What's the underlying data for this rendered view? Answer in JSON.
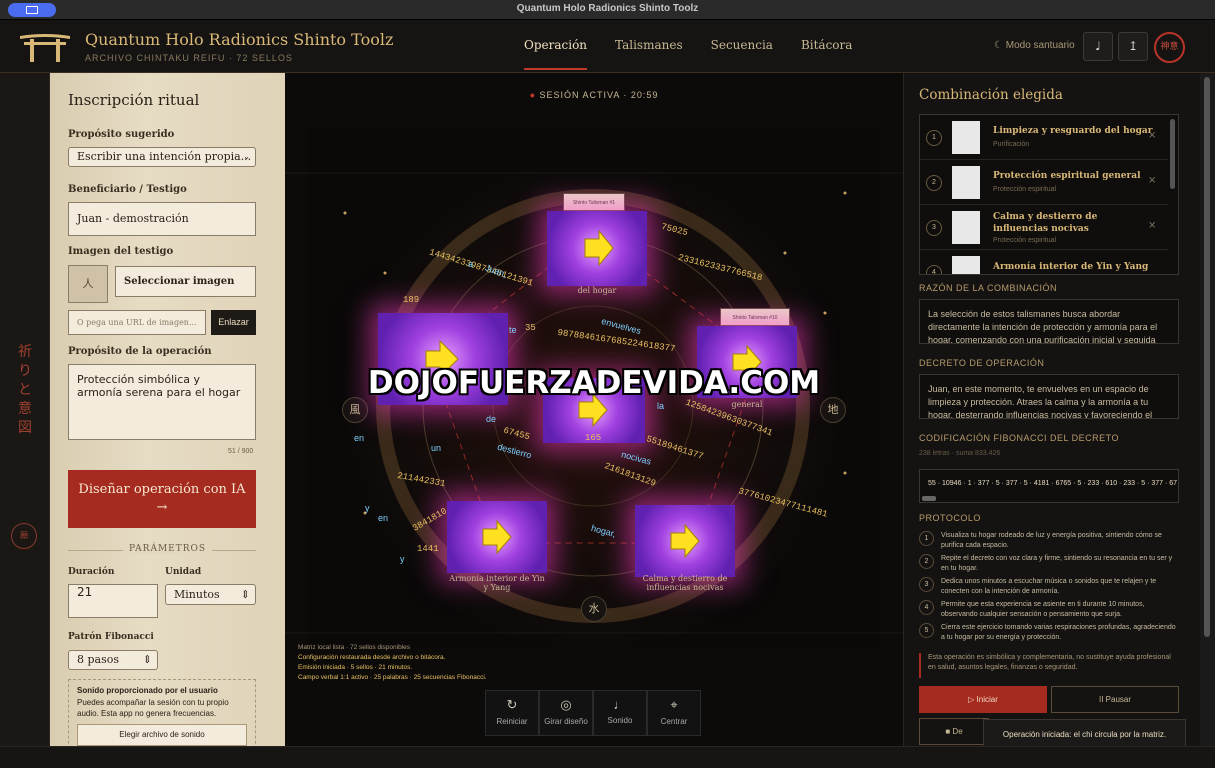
{
  "window": {
    "title": "Quantum Holo Radionics Shinto Toolz"
  },
  "header": {
    "title": "Quantum Holo Radionics Shinto Toolz",
    "subtitle": "ARCHIVO CHINTAKU REIFU · 72 SELLOS",
    "nav": [
      "Operación",
      "Talismanes",
      "Secuencia",
      "Bitácora"
    ],
    "sanctuary": "Modo santuario",
    "music_icon": "♩",
    "upload_icon": "↥",
    "seal": "神意"
  },
  "strip": {
    "vertical": "祈りと意図",
    "seal": "願"
  },
  "form": {
    "title": "Inscripción ritual",
    "purpose_label": "Propósito sugerido",
    "purpose_value": "Escribir una intención propia...",
    "beneficiary_label": "Beneficiario / Testigo",
    "beneficiary_value": "Juan - demostración",
    "image_label": "Imagen del testigo",
    "image_icon": "人",
    "select_image": "Seleccionar imagen",
    "url_placeholder": "O pega una URL de imagen...",
    "link_btn": "Enlazar",
    "op_label": "Propósito de la operación",
    "op_value": "Protección simbólica y armonía serena para el hogar",
    "counter": "51 / 900",
    "design_btn": "Diseñar operación con IA",
    "design_arrow": "→",
    "params": "PARÁMETROS",
    "duration_label": "Duración",
    "duration_value": "21",
    "unit_label": "Unidad",
    "unit_value": "Minutos",
    "fib_label": "Patrón Fibonacci",
    "fib_value": "8 pasos",
    "sound_title": "Sonido proporcionado por el usuario",
    "sound_text": "Puedes acompañar la sesión con tu propio audio. Esta app no genera frecuencias.",
    "sound_btn": "Elegir archivo de sonido"
  },
  "center": {
    "session": "SESIÓN ACTIVA · 20:59",
    "watermark": "DOJOFUERZADEVIDA.COM",
    "elements": {
      "wind": "風",
      "earth": "地",
      "water": "水"
    },
    "talismans": [
      {
        "tag": "Shinto Talisman #1",
        "label": "del hogar"
      },
      {
        "tag": "Shinto Talisman #10",
        "label": "general"
      },
      {
        "tag": "",
        "label": "Armonía interior de Yin y Yang"
      },
      {
        "tag": "",
        "label": "Calma y destierro de influencias nocivas"
      }
    ],
    "fib_numbers": [
      "14434233987345121391",
      "2331623337766518",
      "75025",
      "9878846167685224618377",
      "12584239630377341",
      "55189461377",
      "2161813129",
      "37761023477111481",
      "211442331",
      "3841810",
      "1441",
      "67455",
      "165",
      "35",
      "189"
    ],
    "fib_words": [
      "a",
      "Juan,",
      "envuelves",
      "te",
      "la",
      "de",
      "un",
      "destierro",
      "nocivas",
      "hogar,",
      "en",
      "y",
      "en",
      "y"
    ],
    "log": [
      "Matriz local lista · 72 sellos disponibles",
      "Configuración restaurada desde archivo o bitácora.",
      "Emisión iniciada · 5 sellos · 21 minutos.",
      "Campo verbal 1:1 activo · 25 palabras · 25 secuencias Fibonacci."
    ],
    "controls": [
      {
        "icon": "↻",
        "label": "Reiniciar"
      },
      {
        "icon": "◎",
        "label": "Girar diseño"
      },
      {
        "icon": "♩",
        "label": "Sonido"
      },
      {
        "icon": "⌖",
        "label": "Centrar"
      }
    ]
  },
  "right": {
    "title": "Combinación elegida",
    "items": [
      {
        "n": "1",
        "name": "Limpieza y resguardo del hogar",
        "cat": "Purificación"
      },
      {
        "n": "2",
        "name": "Protección espiritual general",
        "cat": "Protección espiritual"
      },
      {
        "n": "3",
        "name": "Calma y destierro de influencias nocivas",
        "cat": "Protección espiritual"
      },
      {
        "n": "4",
        "name": "Armonía interior de Yin y Yang",
        "cat": ""
      }
    ],
    "reason_label": "RAZÓN DE LA COMBINACIÓN",
    "reason_text": "La selección de estos talismanes busca abordar directamente la intención de protección y armonía para el hogar, comenzando con una purificación inicial y seguida de una",
    "decree_label": "DECRETO DE OPERACIÓN",
    "decree_text": "Juan, en este momento, te envuelves en un espacio de limpieza y protección. Atraes la calma y la armonía a tu hogar, desterrando influencias nocivas y favoreciendo el",
    "fib_label": "CODIFICACIÓN FIBONACCI DEL DECRETO",
    "fib_meta": "238 letras · suma 833.426",
    "fib_text": "55 · 10946 · 1 · 377 · 5 · 377 · 5 · 4181 · 6765 · 5 · 233 · 610 · 233 · 5 · 377 · 67",
    "protocol_label": "PROTOCOLO",
    "protocol": [
      "Visualiza tu hogar rodeado de luz y energía positiva, sintiendo cómo se purifica cada espacio.",
      "Repite el decreto con voz clara y firme, sintiendo su resonancia en tu ser y en tu hogar.",
      "Dedica unos minutos a escuchar música o sonidos que te relajen y te conecten con la intención de armonía.",
      "Permite que esta experiencia se asiente en ti durante 10 minutos, observando cualquier sensación o pensamiento que surja.",
      "Cierra este ejercicio tomando varias respiraciones profundas, agradeciendo a tu hogar por su energía y protección."
    ],
    "disclaimer": "Esta operación es simbólica y complementaria, no sustituye ayuda profesional en salud, asuntos legales, finanzas o seguridad.",
    "start_btn": "▷ Iniciar",
    "pause_btn": "II Pausar",
    "stop_btn": "■ De",
    "toast": "Operación iniciada: el chi circula por la matriz."
  }
}
